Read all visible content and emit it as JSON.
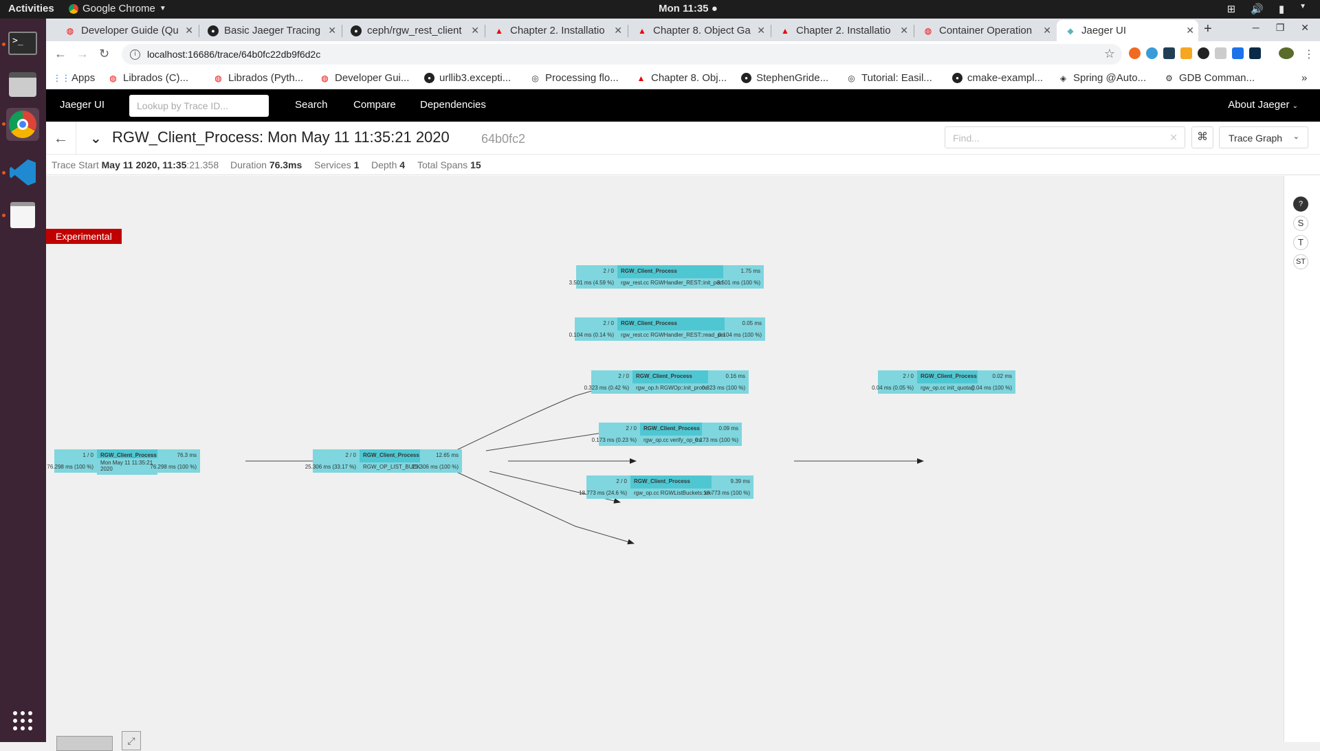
{
  "os": {
    "activities": "Activities",
    "app_name": "Google Chrome",
    "clock": "Mon 11:35 ●"
  },
  "tabs": [
    {
      "label": "Developer Guide (Qu",
      "icon": "redhat-icon"
    },
    {
      "label": "Basic Jaeger Tracing",
      "icon": "github-icon"
    },
    {
      "label": "ceph/rgw_rest_client",
      "icon": "github-icon"
    },
    {
      "label": "Chapter 2. Installatio",
      "icon": "redhat-icon"
    },
    {
      "label": "Chapter 8. Object Ga",
      "icon": "redhat-icon"
    },
    {
      "label": "Chapter 2. Installatio",
      "icon": "redhat-icon"
    },
    {
      "label": "Container Operation",
      "icon": "redhat-icon"
    },
    {
      "label": "Jaeger UI",
      "icon": "jaeger-icon",
      "active": true
    }
  ],
  "address": {
    "url": "localhost:16686/trace/64b0fc22db9f6d2c"
  },
  "bookmarks": [
    {
      "label": "Apps",
      "icon": "apps-icon"
    },
    {
      "label": "Librados (C)...",
      "icon": "redhat-icon"
    },
    {
      "label": "Librados (Pyth...",
      "icon": "redhat-icon"
    },
    {
      "label": "Developer Gui...",
      "icon": "redhat-icon"
    },
    {
      "label": "urllib3.excepti...",
      "icon": "github-icon"
    },
    {
      "label": "Processing flo...",
      "icon": "globe-icon"
    },
    {
      "label": "Chapter 8. Obj...",
      "icon": "redhat-icon"
    },
    {
      "label": "StephenGride...",
      "icon": "github-icon"
    },
    {
      "label": "Tutorial: Easil...",
      "icon": "globe-icon"
    },
    {
      "label": "cmake-exampl...",
      "icon": "github-icon"
    },
    {
      "label": "Spring @Auto...",
      "icon": "spring-icon"
    },
    {
      "label": "GDB Comman...",
      "icon": "gear-icon"
    }
  ],
  "jaeger_nav": {
    "brand": "Jaeger UI",
    "lookup_placeholder": "Lookup by Trace ID...",
    "search": "Search",
    "compare": "Compare",
    "dependencies": "Dependencies",
    "about": "About Jaeger"
  },
  "trace": {
    "title": "RGW_Client_Process: Mon May 11 11:35:21 2020",
    "trace_id": "64b0fc2",
    "find_placeholder": "Find...",
    "view_mode": "Trace Graph",
    "summary": {
      "start_label": "Trace Start",
      "start_value": "May 11 2020, 11:35",
      "start_ms": ":21.358",
      "duration_label": "Duration",
      "duration_value": "76.3ms",
      "services_label": "Services",
      "services_value": "1",
      "depth_label": "Depth",
      "depth_value": "4",
      "spans_label": "Total Spans",
      "spans_value": "15"
    }
  },
  "graph": {
    "badge": "Experimental",
    "side_buttons": [
      "?",
      "S",
      "T",
      "ST"
    ],
    "nodes": [
      {
        "count": "1 / 0",
        "service": "RGW_Client_Process",
        "self": "76.3 ms",
        "total": "76.298 ms (100 %)",
        "op": "Mon May 11 11:35:21 2020",
        "pct": "76.298 ms (100 %)"
      },
      {
        "count": "2 / 0",
        "service": "RGW_Client_Process",
        "self": "12.65 ms",
        "total": "25.306 ms (33.17 %)",
        "op": "RGW_OP_LIST_BUCKETS",
        "pct": "25.306 ms (100 %)"
      },
      {
        "count": "2 / 0",
        "service": "RGW_Client_Process",
        "self": "1.75 ms",
        "total": "3.501 ms (4.59 %)",
        "op": "rgw_rest.cc RGWHandler_REST::init_permissions()",
        "pct": "3.501 ms (100 %)"
      },
      {
        "count": "2 / 0",
        "service": "RGW_Client_Process",
        "self": "0.05 ms",
        "total": "0.104 ms (0.14 %)",
        "op": "rgw_rest.cc RGWHandler_REST::read_permissions()",
        "pct": "0.104 ms (100 %)"
      },
      {
        "count": "2 / 0",
        "service": "RGW_Client_Process",
        "self": "0.16 ms",
        "total": "0.323 ms (0.42 %)",
        "op": "rgw_op.h RGWOp::init_processing()",
        "pct": "0.323 ms (100 %)"
      },
      {
        "count": "2 / 0",
        "service": "RGW_Client_Process",
        "self": "0.02 ms",
        "total": "0.04 ms (0.05 %)",
        "op": "rgw_op.cc init_quota()",
        "pct": "0.04 ms (100 %)"
      },
      {
        "count": "2 / 0",
        "service": "RGW_Client_Process",
        "self": "0.09 ms",
        "total": "0.173 ms (0.23 %)",
        "op": "rgw_op.cc verify_op_mask()",
        "pct": "0.173 ms (100 %)"
      },
      {
        "count": "2 / 0",
        "service": "RGW_Client_Process",
        "self": "9.39 ms",
        "total": "18.773 ms (24.6 %)",
        "op": "rgw_op.cc RGWListBuckets::execute()",
        "pct": "18.773 ms (100 %)"
      }
    ]
  }
}
